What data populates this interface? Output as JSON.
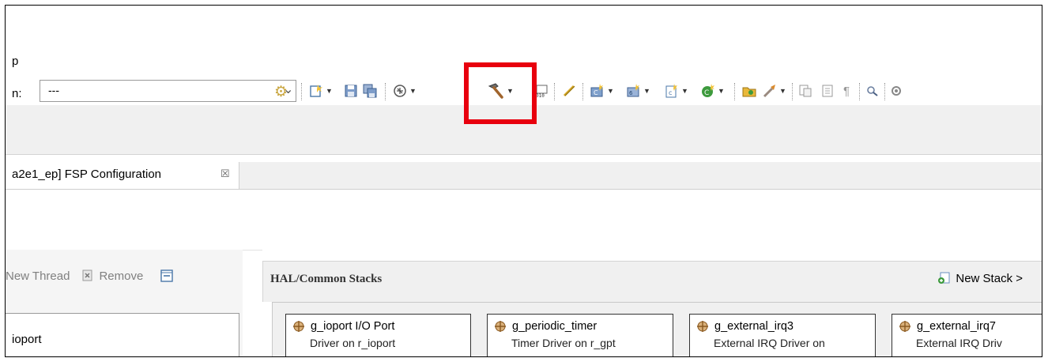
{
  "menu": {
    "fragment": "p"
  },
  "toolbar": {
    "config_label": "n:",
    "config_value": "---",
    "icons": [
      "gear-icon",
      "new-file-icon",
      "save-icon",
      "save-all-icon",
      "debug-config-icon",
      "build-hammer-icon",
      "binary-icon",
      "link-icon",
      "new-c-project-icon",
      "new-class-icon",
      "new-source-icon",
      "new-element-icon",
      "open-folder-icon",
      "run-icon",
      "toggle-icon",
      "block-icon",
      "pilcrow-icon",
      "search-icon",
      "settings-icon"
    ]
  },
  "editor_tab": {
    "label": "a2e1_ep] FSP Configuration",
    "close": "☒"
  },
  "threads": {
    "new_thread_label": "New Thread",
    "remove_label": "Remove",
    "items": [
      "ioport"
    ]
  },
  "stacks": {
    "title": "HAL/Common Stacks",
    "new_stack_label": "New Stack >",
    "cards": [
      {
        "title": "g_ioport I/O Port",
        "subtitle": "Driver on r_ioport"
      },
      {
        "title": "g_periodic_timer",
        "subtitle": "Timer Driver on r_gpt"
      },
      {
        "title": "g_external_irq3",
        "subtitle": "External IRQ Driver on"
      },
      {
        "title": "g_external_irq7",
        "subtitle": "External IRQ Driv"
      }
    ]
  },
  "highlight": {
    "color": "#e8000e"
  }
}
